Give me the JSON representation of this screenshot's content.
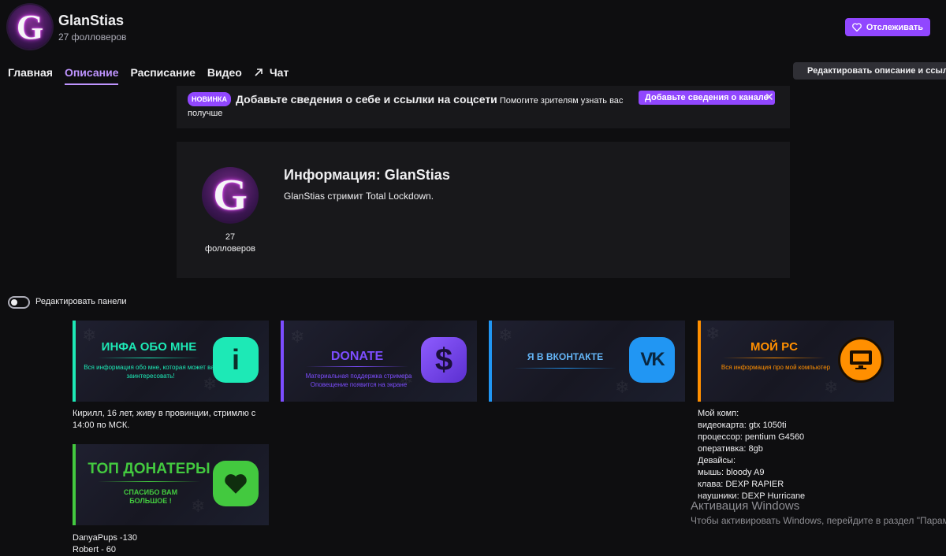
{
  "channel": {
    "name": "GlanStias",
    "followers": "27 фолловеров",
    "avatar_letter": "G"
  },
  "header": {
    "follow_label": "Отслеживать"
  },
  "tabs": [
    {
      "label": "Главная"
    },
    {
      "label": "Описание"
    },
    {
      "label": "Расписание"
    },
    {
      "label": "Видео"
    },
    {
      "label": "Чат"
    }
  ],
  "edit_description_label": "Редактировать описание и ссылки",
  "notice": {
    "badge": "НОВИНКА",
    "title": "Добавьте сведения о себе и ссылки на соцсети",
    "text": "Помогите зрителям узнать вас получше",
    "cta": "Добавьте сведения о канале",
    "close": "✕"
  },
  "info": {
    "title": "Информация: GlanStias",
    "text": "GlanStias стримит Total Lockdown.",
    "followers_count": "27",
    "followers_word": "фолловеров"
  },
  "edit_panels_label": "Редактировать панели",
  "panels": [
    {
      "title": "ИНФА ОБО МНЕ",
      "subtitle": "Вся информация обо мне, которая может вас заинтересовать!",
      "icon": "i",
      "accent": "#1de9b6",
      "desc": [
        "Кирилл, 16 лет, живу в провинции, стримлю с",
        "14:00 по МСК."
      ]
    },
    {
      "title": "DONATE",
      "subtitle": "Материальная поддержка стримера Оповещение появится на экране",
      "icon": "$",
      "accent": "#7c4dff",
      "desc": []
    },
    {
      "title": "Я В ВКОНТАКТЕ",
      "subtitle": "",
      "icon": "vk-icon",
      "accent": "#2196f3",
      "desc": []
    },
    {
      "title": "МОЙ PC",
      "subtitle": "Вся информация про мой компьютер",
      "icon": "monitor-icon",
      "accent": "#ff8f00",
      "desc": [
        "Мой комп:",
        "видеокарта: gtx 1050ti",
        "процессор: pentium G4560",
        "оперативка: 8gb",
        "Девайсы:",
        "мышь: bloody A9",
        "клава: DEXP RAPIER",
        "наушники: DEXP Hurricane"
      ]
    },
    {
      "title": "ТОП ДОНАТЕРЫ",
      "subtitle": "СПАСИБО ВАМ БОЛЬШОЕ !",
      "icon": "heart-icon",
      "accent": "#43c93f",
      "desc": [
        "DanyaPups -130",
        "Robert - 60"
      ]
    }
  ],
  "windows_watermark": {
    "title": "Активация Windows",
    "text": "Чтобы активировать Windows, перейдите в раздел \"Параметры\""
  }
}
